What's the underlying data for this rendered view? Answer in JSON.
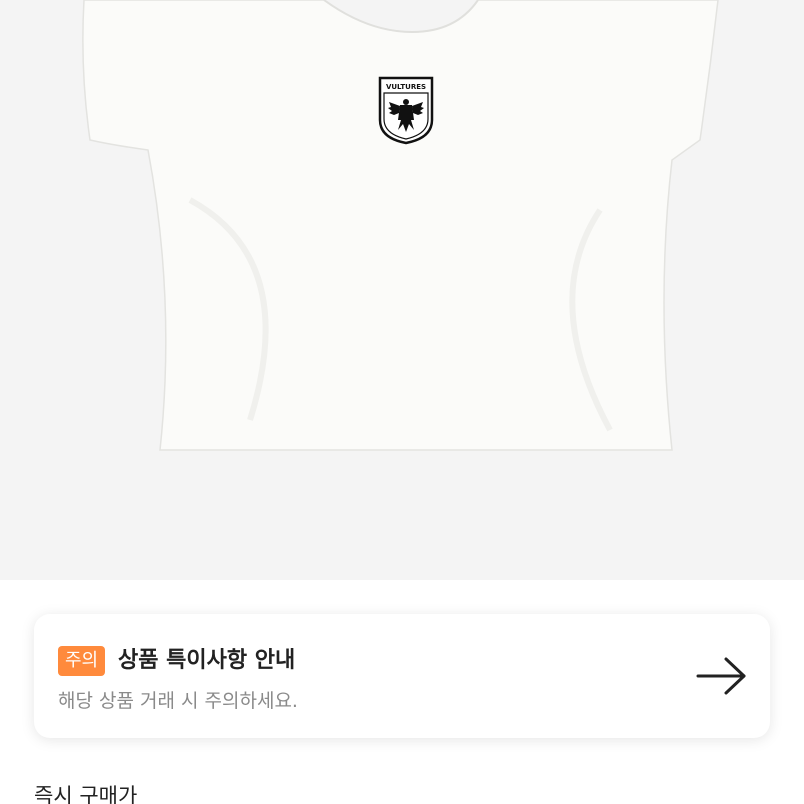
{
  "product": {
    "image_name": "white-cropped-tee",
    "logo_text": "VULTURES"
  },
  "notice": {
    "badge": "주의",
    "title": "상품 특이사항 안내",
    "subtitle": "해당 상품 거래 시 주의하세요.",
    "arrow_icon": "arrow-right-icon",
    "badge_color": "#ff8a3c"
  },
  "price_section": {
    "label": "즉시 구매가"
  }
}
